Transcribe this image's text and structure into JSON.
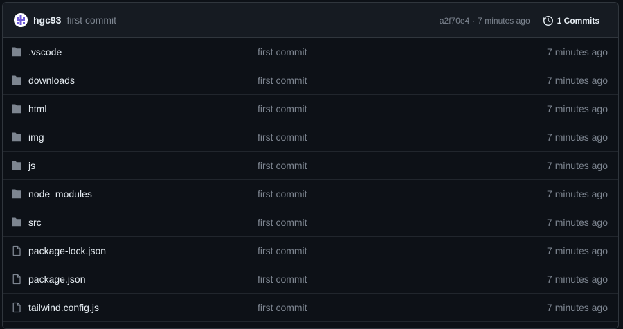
{
  "latest_commit": {
    "author": "hgc93",
    "message": "first commit",
    "sha": "a2f70e4",
    "separator": "·",
    "time": "7 minutes ago",
    "commits_label": "1 Commits"
  },
  "files": [
    {
      "name": ".vscode",
      "type": "folder",
      "message": "first commit",
      "time": "7 minutes ago"
    },
    {
      "name": "downloads",
      "type": "folder",
      "message": "first commit",
      "time": "7 minutes ago"
    },
    {
      "name": "html",
      "type": "folder",
      "message": "first commit",
      "time": "7 minutes ago"
    },
    {
      "name": "img",
      "type": "folder",
      "message": "first commit",
      "time": "7 minutes ago"
    },
    {
      "name": "js",
      "type": "folder",
      "message": "first commit",
      "time": "7 minutes ago"
    },
    {
      "name": "node_modules",
      "type": "folder",
      "message": "first commit",
      "time": "7 minutes ago"
    },
    {
      "name": "src",
      "type": "folder",
      "message": "first commit",
      "time": "7 minutes ago"
    },
    {
      "name": "package-lock.json",
      "type": "file",
      "message": "first commit",
      "time": "7 minutes ago"
    },
    {
      "name": "package.json",
      "type": "file",
      "message": "first commit",
      "time": "7 minutes ago"
    },
    {
      "name": "tailwind.config.js",
      "type": "file",
      "message": "first commit",
      "time": "7 minutes ago"
    }
  ],
  "colors": {
    "background": "#0d1117",
    "header_bg": "#161b22",
    "border": "#30363d",
    "text": "#e6edf3",
    "muted": "#7d8590",
    "icon": "#7d8590"
  }
}
